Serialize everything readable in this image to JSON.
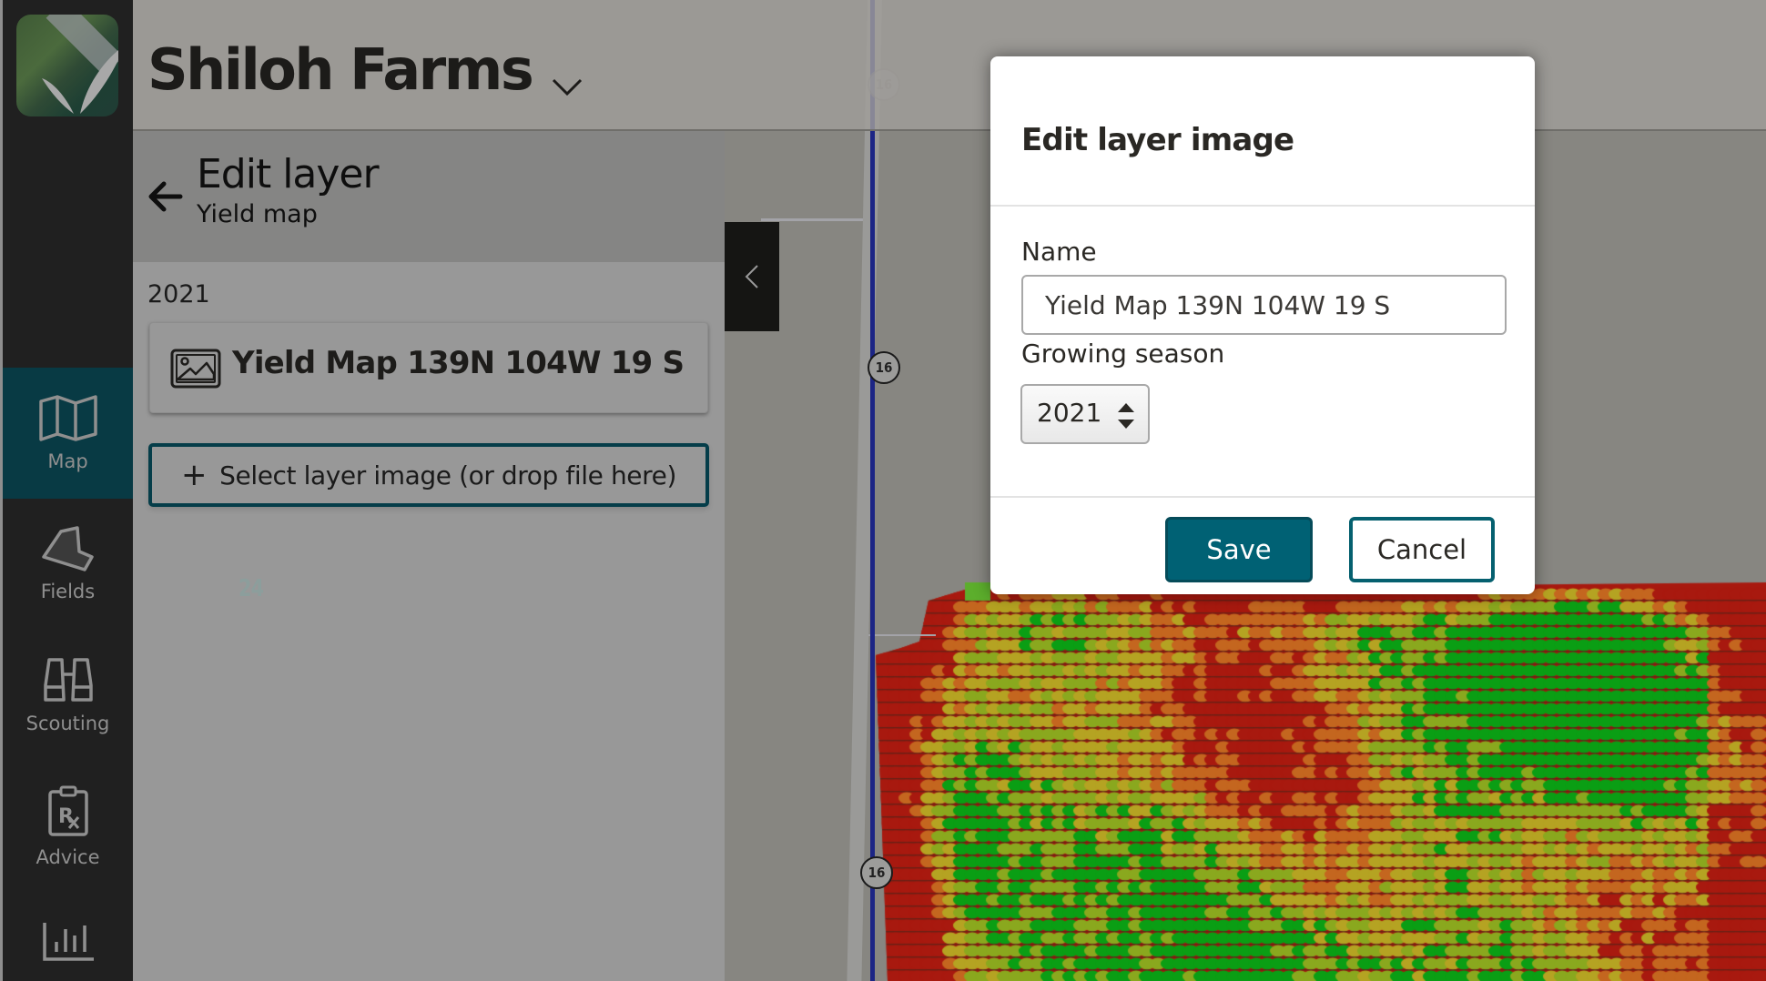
{
  "header": {
    "farm_name": "Shiloh Farms",
    "farm_switcher_icon": "chevron-down-icon"
  },
  "nav": {
    "items": [
      {
        "label": "Map",
        "icon": "map-icon",
        "active": true
      },
      {
        "label": "Fields",
        "icon": "field-polygon-icon",
        "active": false
      },
      {
        "label": "Scouting",
        "icon": "binoculars-icon",
        "active": false
      },
      {
        "label": "Advice",
        "icon": "prescription-clipboard-icon",
        "active": false
      },
      {
        "label": "",
        "icon": "bar-chart-icon",
        "active": false
      }
    ]
  },
  "panel": {
    "title": "Edit layer",
    "subtitle": "Yield map",
    "back_icon": "arrow-left-icon",
    "year": "2021",
    "layer_card": {
      "icon": "image-icon",
      "name": "Yield Map 139N 104W 19 S"
    },
    "select_button": {
      "icon": "plus-icon",
      "label": "Select layer image (or drop file here)"
    },
    "collapse_icon": "chevron-left-icon"
  },
  "map": {
    "route_label": "16",
    "faint_label": "24",
    "yield_colors": {
      "high": "#0a9e14",
      "mid_high": "#8aa81e",
      "mid": "#b5a322",
      "mid_low": "#c4661f",
      "low": "#a8190f"
    },
    "route_color": "#1c2585"
  },
  "dialog": {
    "title": "Edit layer image",
    "name_label": "Name",
    "name_value": "Yield Map 139N 104W 19 S",
    "season_label": "Growing season",
    "season_value": "2021",
    "save_label": "Save",
    "cancel_label": "Cancel",
    "accent_color": "#006174"
  }
}
